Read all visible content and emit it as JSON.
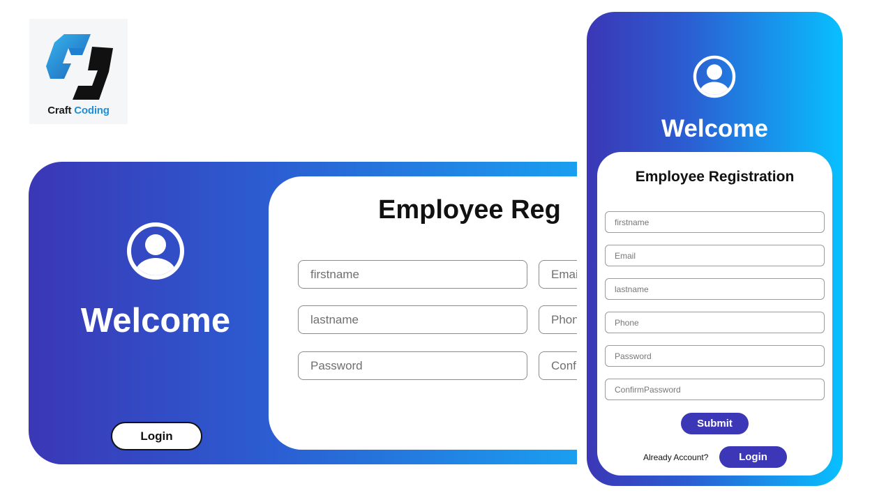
{
  "logo": {
    "word1": "Craft",
    "word2": "Coding",
    "icon": "craft-coding-logo-icon"
  },
  "colors": {
    "gradient_start": "#3b37b6",
    "gradient_end": "#08c0ff",
    "button": "#3b37b6"
  },
  "desktop": {
    "welcome": "Welcome",
    "login_label": "Login",
    "title": "Employee Reg",
    "placeholders": {
      "firstname": "firstname",
      "email": "Email",
      "lastname": "lastname",
      "phone": "Phone",
      "password": "Password",
      "confirm": "ConfirmPassword"
    }
  },
  "mobile": {
    "welcome": "Welcome",
    "title": "Employee Registration",
    "placeholders": {
      "firstname": "firstname",
      "email": "Email",
      "lastname": "lastname",
      "phone": "Phone",
      "password": "Password",
      "confirm": "ConfirmPassword"
    },
    "submit_label": "Submit",
    "already_text": "Already Account?",
    "login_label": "Login"
  }
}
